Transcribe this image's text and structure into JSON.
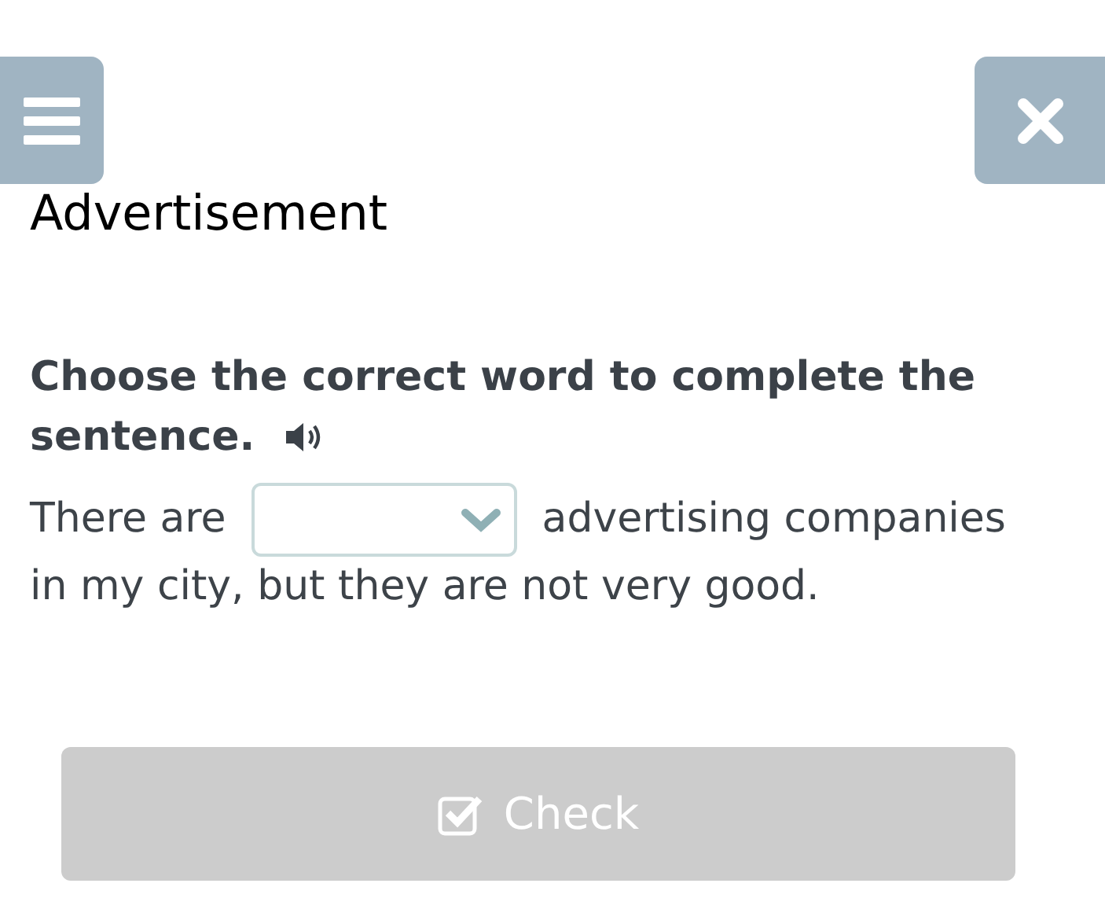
{
  "title": "Advertisement",
  "instruction_lines": [
    "Choose the correct word to complete the",
    "sentence."
  ],
  "sentence": {
    "before": "There are",
    "after_lines": [
      "advertising companies",
      "in my city, but they are not very good."
    ]
  },
  "check_button": {
    "label": "Check",
    "disabled": true
  }
}
